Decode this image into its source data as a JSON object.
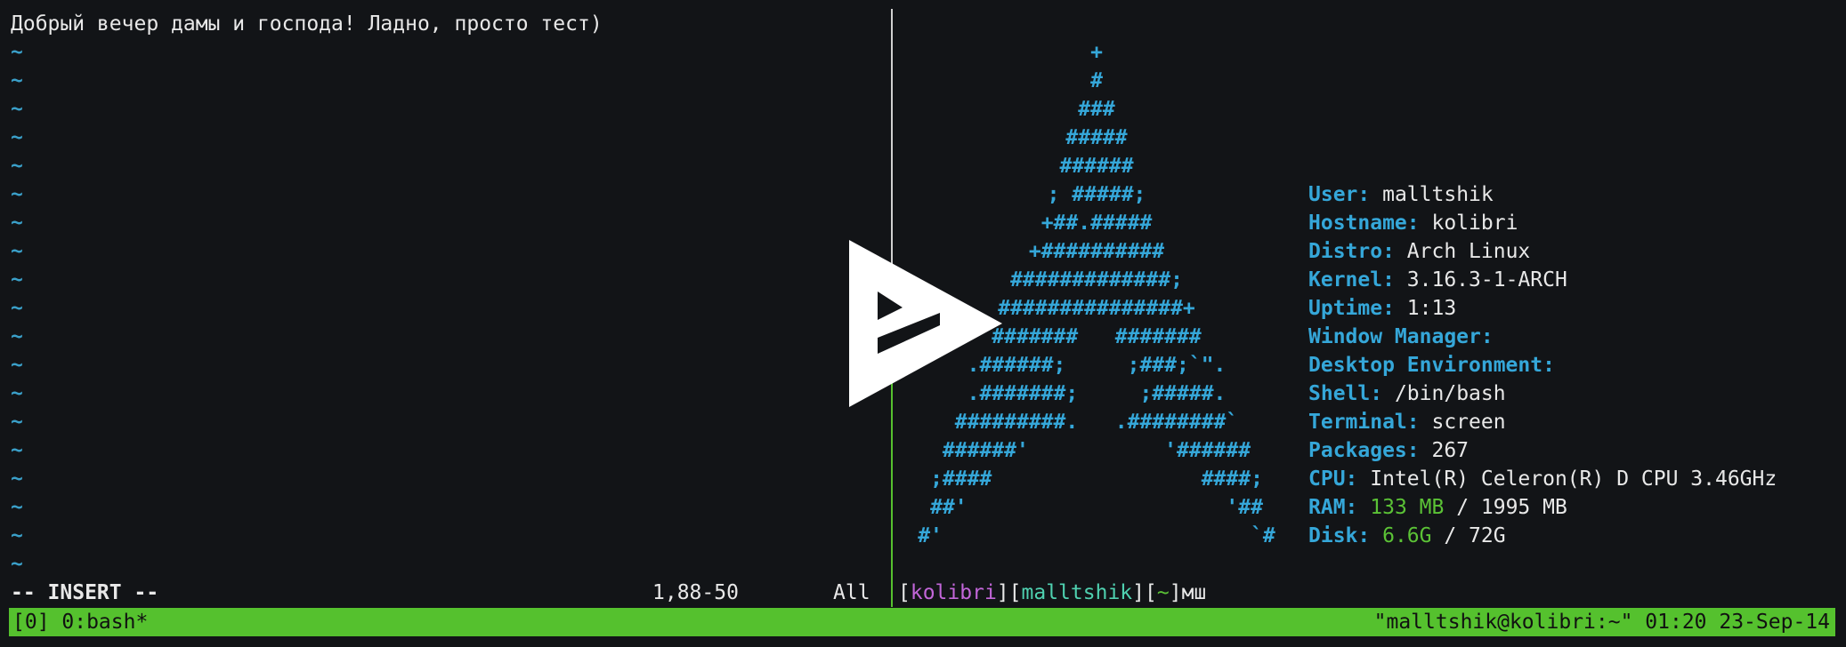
{
  "vim": {
    "first_line": "Добрый вечер дамы и господа! Ладно, просто тест)",
    "tilde": "~",
    "mode": "-- INSERT --",
    "position": "1,88-50",
    "scroll": "All"
  },
  "logo": [
    "+",
    "#",
    "###",
    "#####",
    "######",
    "; #####;",
    "+##.#####",
    "+##########",
    "#############;",
    "###############+",
    "#######   #######",
    ".######;     ;###;`\".",
    ".#######;     ;#####.",
    "#########.   .########`",
    "######'           '######",
    ";####                 ####;",
    "##'                     '##",
    "#'                         `#"
  ],
  "sysinfo": [
    {
      "label": "User:",
      "value": "malltshik"
    },
    {
      "label": "Hostname:",
      "value": "kolibri"
    },
    {
      "label": "Distro:",
      "value": "Arch Linux"
    },
    {
      "label": "Kernel:",
      "value": "3.16.3-1-ARCH"
    },
    {
      "label": "Uptime:",
      "value": "1:13"
    },
    {
      "label": "Window Manager:",
      "value": ""
    },
    {
      "label": "Desktop Environment:",
      "value": ""
    },
    {
      "label": "Shell:",
      "value": "/bin/bash"
    },
    {
      "label": "Terminal:",
      "value": "screen"
    },
    {
      "label": "Packages:",
      "value": "267"
    },
    {
      "label": "CPU:",
      "value": "Intel(R) Celeron(R) D CPU 3.46GHz"
    }
  ],
  "ram": {
    "label": "RAM:",
    "used": "133 MB",
    "sep": " / ",
    "total": "1995 MB"
  },
  "disk": {
    "label": "Disk:",
    "used": "6.6G",
    "sep": " / ",
    "total": "72G"
  },
  "prompt": {
    "open1": "[",
    "host": "kolibri",
    "close1": "]",
    "open2": "[",
    "user": "malltshik",
    "close2": "]",
    "open3": "[",
    "dir": "~",
    "close3": "]",
    "input": "мш"
  },
  "tmux": {
    "left": "[0] 0:bash*",
    "right": "\"malltshik@kolibri:~\" 01:20 23-Sep-14"
  },
  "colors": {
    "status_bg": "#55c12e",
    "accent_blue": "#35a7d9",
    "tilde_blue": "#3a9fc8",
    "green": "#5bc236",
    "pink": "#c266d9",
    "teal": "#4fd1b0"
  }
}
